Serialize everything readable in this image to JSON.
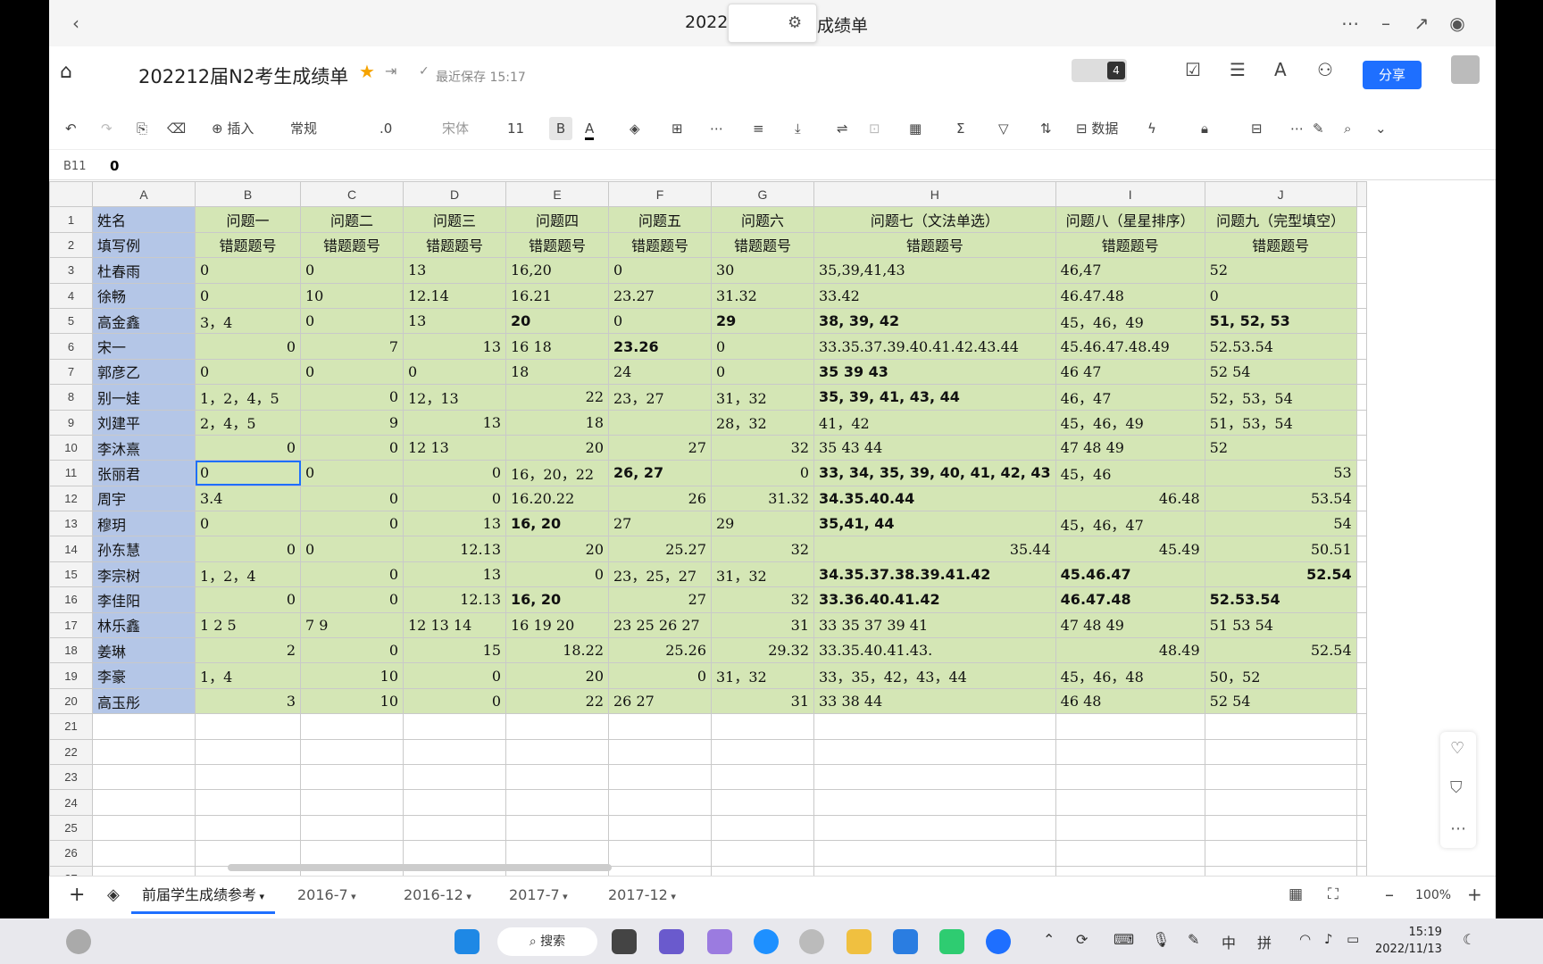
{
  "window": {
    "title_left": "2022",
    "title_right": "成绩单"
  },
  "header": {
    "doc_title": "202212届N2考生成绩单",
    "saved_text": "最近保存 15:17",
    "collab_count": "4",
    "share_label": "分享"
  },
  "toolbar": {
    "insert": "插入",
    "format": "常规",
    "decimal": ".0",
    "font": "宋体",
    "size": "11",
    "bold": "B",
    "text_color": "A",
    "data": "数据"
  },
  "formula": {
    "cell_ref": "B11",
    "value": "0"
  },
  "columns": [
    "A",
    "B",
    "C",
    "D",
    "E",
    "F",
    "G",
    "H",
    "I",
    "J"
  ],
  "grid_rows": [
    {
      "n": "1",
      "c": [
        "姓名",
        "问题一",
        "问题二",
        "问题三",
        "问题四",
        "问题五",
        "问题六",
        "问题七（文法单选）",
        "问题八（星星排序）",
        "问题九（完型填空）"
      ]
    },
    {
      "n": "2",
      "c": [
        "填写例",
        "错题题号",
        "错题题号",
        "错题题号",
        "错题题号",
        "错题题号",
        "错题题号",
        "错题题号",
        "错题题号",
        "错题题号"
      ]
    },
    {
      "n": "3",
      "c": [
        "杜春雨",
        "0",
        "0",
        "13",
        "16,20",
        "0",
        "30",
        "35,39,41,43",
        "46,47",
        "52"
      ]
    },
    {
      "n": "4",
      "c": [
        "徐畅",
        "0",
        "10",
        "12.14",
        "16.21",
        "23.27",
        "31.32",
        "33.42",
        "46.47.48",
        "0"
      ]
    },
    {
      "n": "5",
      "c": [
        "高金鑫",
        "3，4",
        "0",
        "13",
        "20",
        "0",
        "29",
        "38, 39, 42",
        "45，46，49",
        "51, 52, 53"
      ]
    },
    {
      "n": "6",
      "c": [
        "宋一",
        "0",
        "7",
        "13",
        "16 18",
        "23.26",
        "0",
        "33.35.37.39.40.41.42.43.44",
        "45.46.47.48.49",
        "52.53.54"
      ]
    },
    {
      "n": "7",
      "c": [
        "郭彦乙",
        "0",
        "0",
        "0",
        "18",
        "24",
        "0",
        "35 39 43",
        "46 47",
        "52 54"
      ]
    },
    {
      "n": "8",
      "c": [
        "别一娃",
        "1，2，4，5",
        "0",
        "12，13",
        "22",
        "23，27",
        "31，32",
        "35, 39, 41, 43, 44",
        "46，47",
        "52，53，54"
      ]
    },
    {
      "n": "9",
      "c": [
        "刘建平",
        "2，4，5",
        "9",
        "13",
        "18",
        "",
        "28，32",
        "41，42",
        "45，46，49",
        "51，53，54"
      ]
    },
    {
      "n": "10",
      "c": [
        "李沐熹",
        "0",
        "0",
        "12 13",
        "20",
        "27",
        "32",
        "35 43 44",
        "47 48 49",
        "52"
      ]
    },
    {
      "n": "11",
      "c": [
        "张丽君",
        "0",
        "0",
        "0",
        "16，20，22",
        "26, 27",
        "0",
        "33, 34, 35, 39, 40, 41, 42, 43",
        "45，46",
        "53"
      ]
    },
    {
      "n": "12",
      "c": [
        "周宇",
        "3.4",
        "0",
        "0",
        "16.20.22",
        "26",
        "31.32",
        "34.35.40.44",
        "46.48",
        "53.54"
      ]
    },
    {
      "n": "13",
      "c": [
        "穆玥",
        "0",
        "0",
        "13",
        "16, 20",
        "27",
        "29",
        "35,41, 44",
        "45，46，47",
        "54"
      ]
    },
    {
      "n": "14",
      "c": [
        "孙东慧",
        "0",
        "0",
        "12.13",
        "20",
        "25.27",
        "32",
        "35.44",
        "45.49",
        "50.51"
      ]
    },
    {
      "n": "15",
      "c": [
        "李宗树",
        "1，2，4",
        "0",
        "13",
        "0",
        "23，25，27",
        "31，32",
        "34.35.37.38.39.41.42",
        "45.46.47",
        "52.54"
      ]
    },
    {
      "n": "16",
      "c": [
        "李佳阳",
        "0",
        "0",
        "12.13",
        "16, 20",
        "27",
        "32",
        "33.36.40.41.42",
        "46.47.48",
        "52.53.54"
      ]
    },
    {
      "n": "17",
      "c": [
        "林乐鑫",
        "1 2 5",
        "7 9",
        "12 13 14",
        "16 19 20",
        "23 25 26 27",
        "31",
        "33 35 37 39 41",
        "47 48 49",
        "51 53 54"
      ]
    },
    {
      "n": "18",
      "c": [
        "姜琳",
        "2",
        "0",
        "15",
        "18.22",
        "25.26",
        "29.32",
        "33.35.40.41.43.",
        "48.49",
        "52.54"
      ]
    },
    {
      "n": "19",
      "c": [
        "李豪",
        "1，4",
        "10",
        "0",
        "20",
        "0",
        "31，32",
        "33，35，42，43，44",
        "45，46，48",
        "50，52"
      ]
    },
    {
      "n": "20",
      "c": [
        "高玉彤",
        "3",
        "10",
        "0",
        "22",
        "26 27",
        "31",
        "33 38 44",
        "46 48",
        "52 54"
      ]
    }
  ],
  "empty_rows": [
    "21",
    "22",
    "23",
    "24",
    "25",
    "26",
    "27"
  ],
  "tabs": [
    "前届学生成绩参考",
    "2016-7",
    "2016-12",
    "2017-7",
    "2017-12"
  ],
  "status": {
    "zoom": "100%"
  },
  "taskbar": {
    "search": "搜索",
    "ime": "中",
    "ime2": "拼",
    "time": "15:19",
    "date": "2022/11/13"
  }
}
